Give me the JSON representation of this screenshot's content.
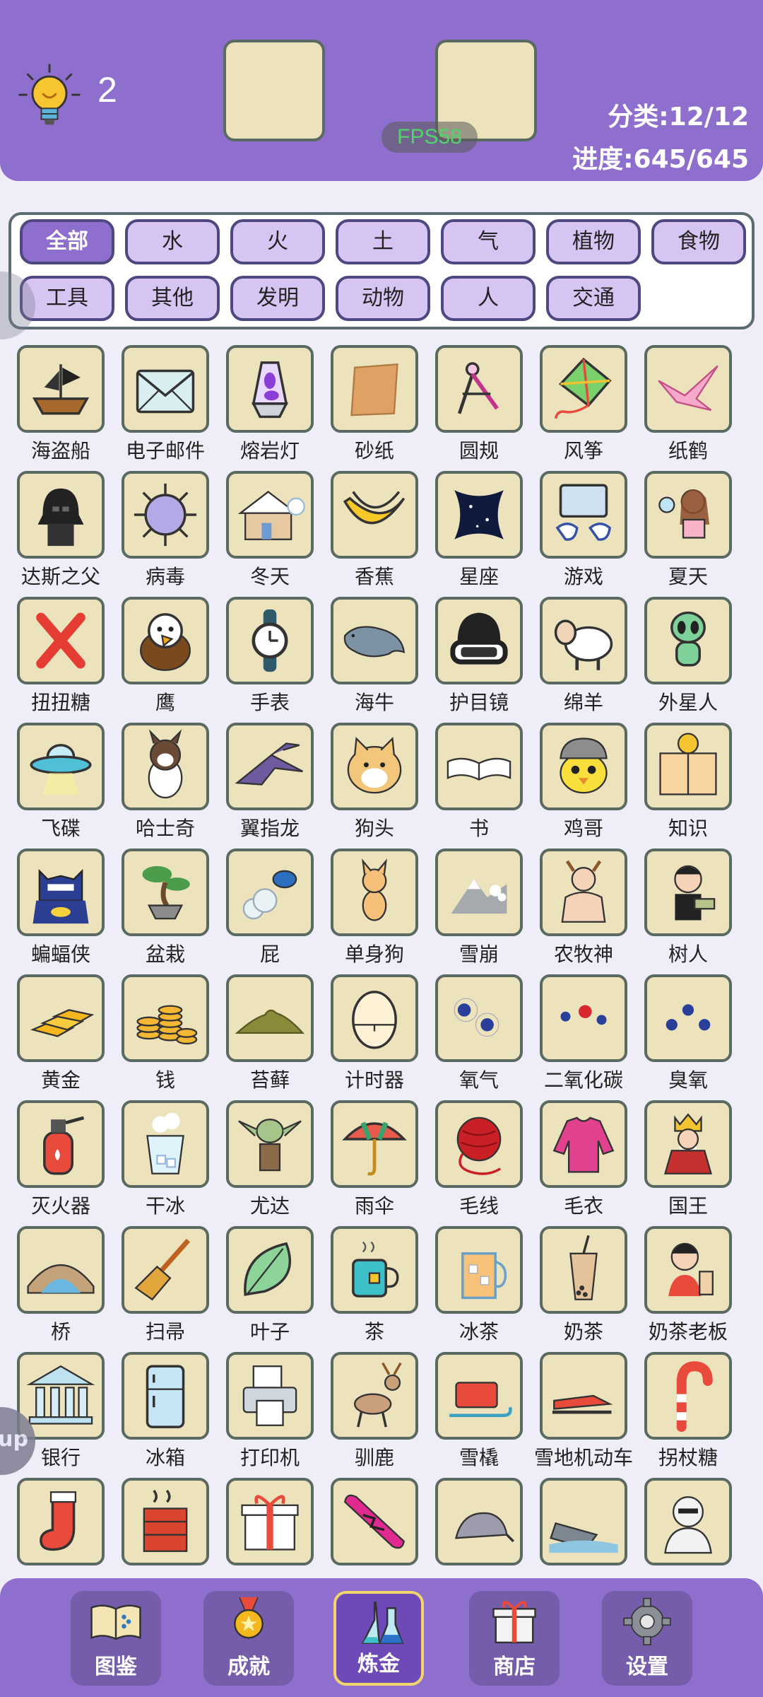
{
  "header": {
    "hint_count": "2",
    "fps": "FPS58",
    "category_stat": "分类:12/12",
    "progress_stat": "进度:645/645"
  },
  "categories": [
    "全部",
    "水",
    "火",
    "土",
    "气",
    "植物",
    "食物",
    "工具",
    "其他",
    "发明",
    "动物",
    "人",
    "交通"
  ],
  "active_category": "全部",
  "side_button": "up",
  "elements": [
    {
      "label": "海盗船",
      "icon": "pirate-ship-icon"
    },
    {
      "label": "电子邮件",
      "icon": "email-envelope-icon"
    },
    {
      "label": "熔岩灯",
      "icon": "lava-lamp-icon"
    },
    {
      "label": "砂纸",
      "icon": "sandpaper-icon"
    },
    {
      "label": "圆规",
      "icon": "compass-tool-icon"
    },
    {
      "label": "风筝",
      "icon": "kite-icon"
    },
    {
      "label": "纸鹤",
      "icon": "paper-crane-icon"
    },
    {
      "label": "达斯之父",
      "icon": "darth-vader-icon"
    },
    {
      "label": "病毒",
      "icon": "virus-icon"
    },
    {
      "label": "冬天",
      "icon": "snowy-house-icon"
    },
    {
      "label": "香蕉",
      "icon": "banana-icon"
    },
    {
      "label": "星座",
      "icon": "constellation-icon"
    },
    {
      "label": "游戏",
      "icon": "game-controller-icon"
    },
    {
      "label": "夏天",
      "icon": "summer-girl-icon"
    },
    {
      "label": "扭扭糖",
      "icon": "twist-candy-icon"
    },
    {
      "label": "鹰",
      "icon": "eagle-icon"
    },
    {
      "label": "手表",
      "icon": "watch-icon"
    },
    {
      "label": "海牛",
      "icon": "manatee-icon"
    },
    {
      "label": "护目镜",
      "icon": "goggles-icon"
    },
    {
      "label": "绵羊",
      "icon": "sheep-icon"
    },
    {
      "label": "外星人",
      "icon": "alien-icon"
    },
    {
      "label": "飞碟",
      "icon": "ufo-icon"
    },
    {
      "label": "哈士奇",
      "icon": "husky-icon"
    },
    {
      "label": "翼指龙",
      "icon": "pterodactyl-icon"
    },
    {
      "label": "狗头",
      "icon": "doge-icon"
    },
    {
      "label": "书",
      "icon": "book-icon"
    },
    {
      "label": "鸡哥",
      "icon": "chicken-bro-icon"
    },
    {
      "label": "知识",
      "icon": "knowledge-book-icon"
    },
    {
      "label": "蝙蝠侠",
      "icon": "batman-icon"
    },
    {
      "label": "盆栽",
      "icon": "bonsai-icon"
    },
    {
      "label": "屁",
      "icon": "fart-icon"
    },
    {
      "label": "单身狗",
      "icon": "single-dog-icon"
    },
    {
      "label": "雪崩",
      "icon": "avalanche-icon"
    },
    {
      "label": "农牧神",
      "icon": "faun-icon"
    },
    {
      "label": "树人",
      "icon": "tree-man-icon"
    },
    {
      "label": "黄金",
      "icon": "gold-bars-icon"
    },
    {
      "label": "钱",
      "icon": "coins-icon"
    },
    {
      "label": "苔藓",
      "icon": "moss-icon"
    },
    {
      "label": "计时器",
      "icon": "egg-timer-icon"
    },
    {
      "label": "氧气",
      "icon": "oxygen-molecule-icon"
    },
    {
      "label": "二氧化碳",
      "icon": "co2-molecule-icon"
    },
    {
      "label": "臭氧",
      "icon": "ozone-molecule-icon"
    },
    {
      "label": "灭火器",
      "icon": "fire-extinguisher-icon"
    },
    {
      "label": "干冰",
      "icon": "dry-ice-icon"
    },
    {
      "label": "尤达",
      "icon": "yoda-icon"
    },
    {
      "label": "雨伞",
      "icon": "umbrella-icon"
    },
    {
      "label": "毛线",
      "icon": "yarn-ball-icon"
    },
    {
      "label": "毛衣",
      "icon": "sweater-icon"
    },
    {
      "label": "国王",
      "icon": "king-icon"
    },
    {
      "label": "桥",
      "icon": "bridge-icon"
    },
    {
      "label": "扫帚",
      "icon": "broom-icon"
    },
    {
      "label": "叶子",
      "icon": "leaf-icon"
    },
    {
      "label": "茶",
      "icon": "tea-mug-icon"
    },
    {
      "label": "冰茶",
      "icon": "iced-tea-icon"
    },
    {
      "label": "奶茶",
      "icon": "milk-tea-icon"
    },
    {
      "label": "奶茶老板",
      "icon": "milk-tea-boss-icon"
    },
    {
      "label": "银行",
      "icon": "bank-icon"
    },
    {
      "label": "冰箱",
      "icon": "fridge-icon"
    },
    {
      "label": "打印机",
      "icon": "printer-icon"
    },
    {
      "label": "驯鹿",
      "icon": "reindeer-icon"
    },
    {
      "label": "雪橇",
      "icon": "sled-icon"
    },
    {
      "label": "雪地机动车",
      "icon": "snowmobile-icon"
    },
    {
      "label": "拐杖糖",
      "icon": "candy-cane-icon"
    },
    {
      "label": "",
      "icon": "stocking-icon"
    },
    {
      "label": "",
      "icon": "chimney-icon"
    },
    {
      "label": "",
      "icon": "gift-icon"
    },
    {
      "label": "",
      "icon": "snowboard-icon"
    },
    {
      "label": "",
      "icon": "armadillo-icon"
    },
    {
      "label": "",
      "icon": "titanic-icon"
    },
    {
      "label": "",
      "icon": "mummy-icon"
    }
  ],
  "nav": [
    {
      "label": "图鉴",
      "icon": "encyclopedia-book-icon"
    },
    {
      "label": "成就",
      "icon": "medal-icon"
    },
    {
      "label": "炼金",
      "icon": "flask-icon"
    },
    {
      "label": "商店",
      "icon": "shop-gift-icon"
    },
    {
      "label": "设置",
      "icon": "gear-icon"
    }
  ],
  "active_nav": "炼金",
  "colors": {
    "header_purple": "#8f6fce",
    "tile_bg": "#ece3bd",
    "tile_border": "#5b6a60",
    "chip_bg": "#d6c4f3",
    "chip_border": "#4d4880",
    "fps_green": "#4fd46a"
  }
}
